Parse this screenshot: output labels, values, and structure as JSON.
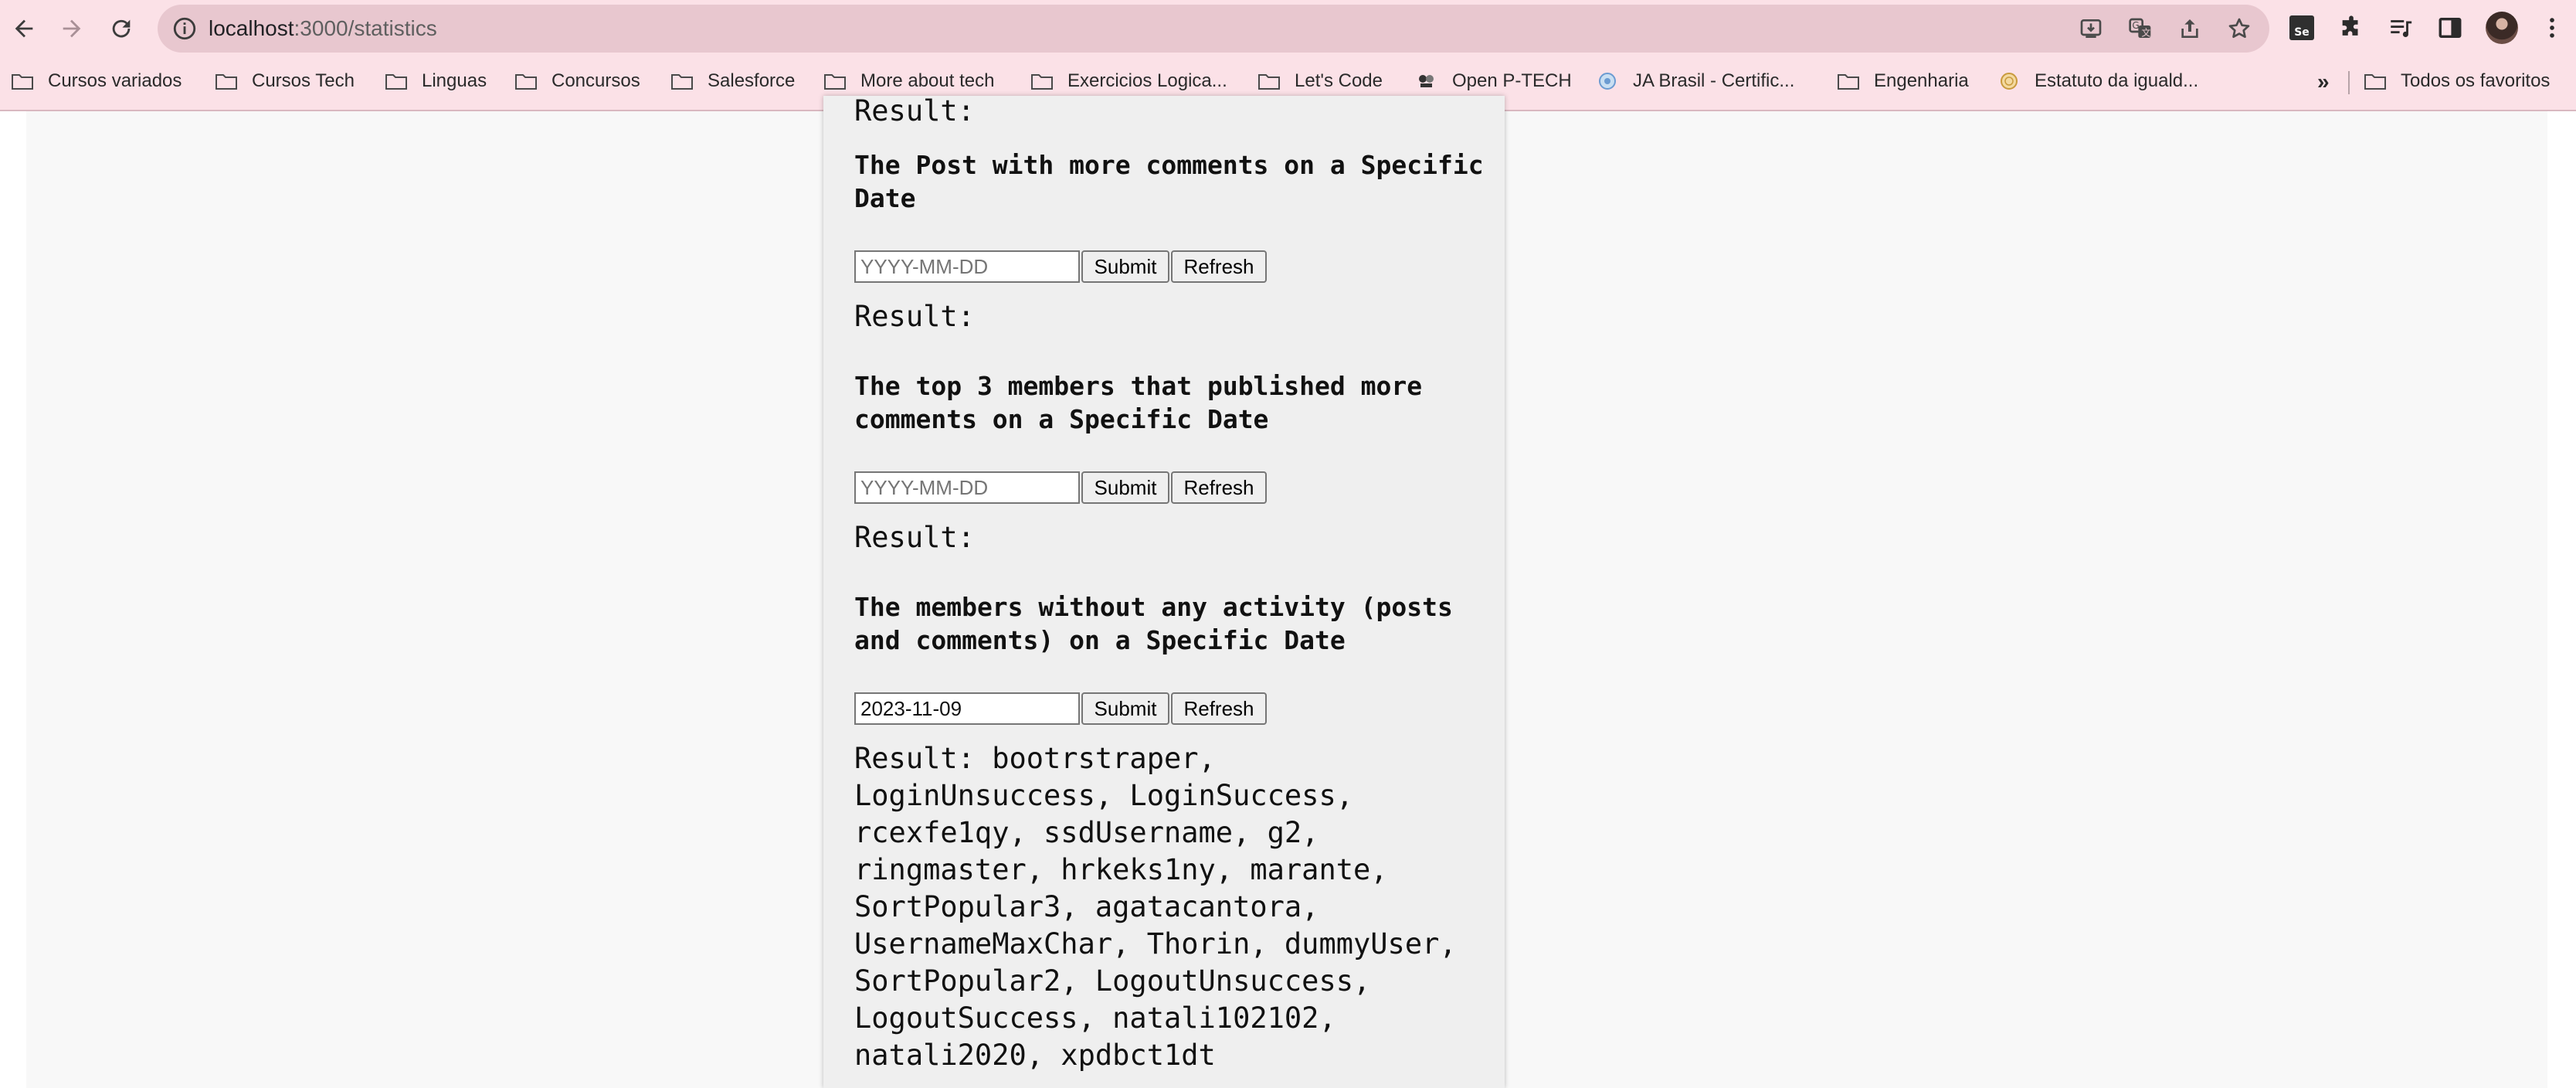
{
  "browser": {
    "url_host": "localhost",
    "url_path": ":3000/statistics",
    "bookmarks": [
      {
        "label": "Cursos variados",
        "icon": "folder-icon"
      },
      {
        "label": "Cursos Tech",
        "icon": "folder-icon"
      },
      {
        "label": "Linguas",
        "icon": "folder-icon"
      },
      {
        "label": "Concursos",
        "icon": "folder-icon"
      },
      {
        "label": "Salesforce",
        "icon": "folder-icon"
      },
      {
        "label": "More about tech",
        "icon": "folder-icon"
      },
      {
        "label": "Exercicios Logica...",
        "icon": "folder-icon"
      },
      {
        "label": "Let's Code",
        "icon": "folder-icon"
      },
      {
        "label": "Open P-TECH",
        "icon": "ptech-logo-icon"
      },
      {
        "label": "JA Brasil - Certific...",
        "icon": "ja-logo-icon"
      },
      {
        "label": "Engenharia",
        "icon": "folder-icon"
      },
      {
        "label": "Estatuto da iguald...",
        "icon": "seal-icon"
      }
    ],
    "bookmarks_overflow": "»",
    "all_bookmarks": "Todos os favoritos"
  },
  "page": {
    "top_result_label": "Result:",
    "sections": [
      {
        "heading": "The Post with more comments on a Specific Date",
        "input_value": "",
        "input_placeholder": "YYYY-MM-DD",
        "submit_label": "Submit",
        "refresh_label": "Refresh",
        "result": "Result:"
      },
      {
        "heading": "The top 3 members that published more comments on a Specific Date",
        "input_value": "",
        "input_placeholder": "YYYY-MM-DD",
        "submit_label": "Submit",
        "refresh_label": "Refresh",
        "result": "Result:"
      },
      {
        "heading": "The members without any activity (posts and comments) on a Specific Date",
        "input_value": "2023-11-09",
        "input_placeholder": "YYYY-MM-DD",
        "submit_label": "Submit",
        "refresh_label": "Refresh",
        "result": "Result: bootrstraper, LoginUnsuccess, LoginSuccess, rcexfe1qy, ssdUsername, g2, ringmaster, hrkeks1ny, marante, SortPopular3, agatacantora, UsernameMaxChar, Thorin, dummyUser, SortPopular2, LogoutUnsuccess, LogoutSuccess, natali102102, natali2020, xpdbct1dt"
      }
    ]
  }
}
